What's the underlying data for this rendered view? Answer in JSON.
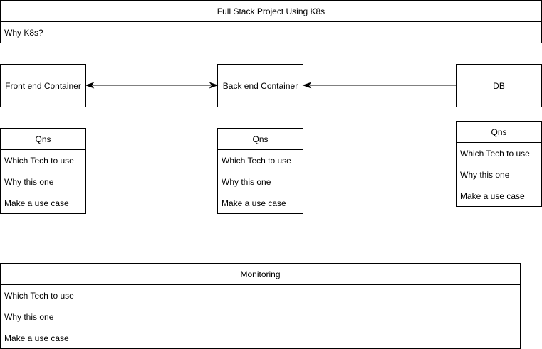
{
  "title_box": {
    "title": "Full Stack Project Using K8s",
    "subtitle": "Why K8s?"
  },
  "containers": {
    "frontend": "Front end Container",
    "backend": "Back end Container",
    "db": "DB"
  },
  "question_lists": {
    "frontend": {
      "header": "Qns",
      "items": [
        "Which Tech to use",
        "Why this one",
        "Make a use case"
      ]
    },
    "backend": {
      "header": "Qns",
      "items": [
        "Which Tech to use",
        "Why this one",
        "Make a use case"
      ]
    },
    "db": {
      "header": "Qns",
      "items": [
        "Which Tech to use",
        "Why this one",
        "Make a use case"
      ]
    }
  },
  "monitoring": {
    "header": "Monitoring",
    "items": [
      "Which Tech to use",
      "Why this one",
      "Make a use case"
    ]
  },
  "connections": [
    {
      "from": "frontend",
      "to": "backend",
      "type": "bidirectional"
    },
    {
      "from": "db",
      "to": "backend",
      "type": "directed"
    }
  ],
  "colors": {
    "stroke": "#000000",
    "fill": "#ffffff"
  }
}
